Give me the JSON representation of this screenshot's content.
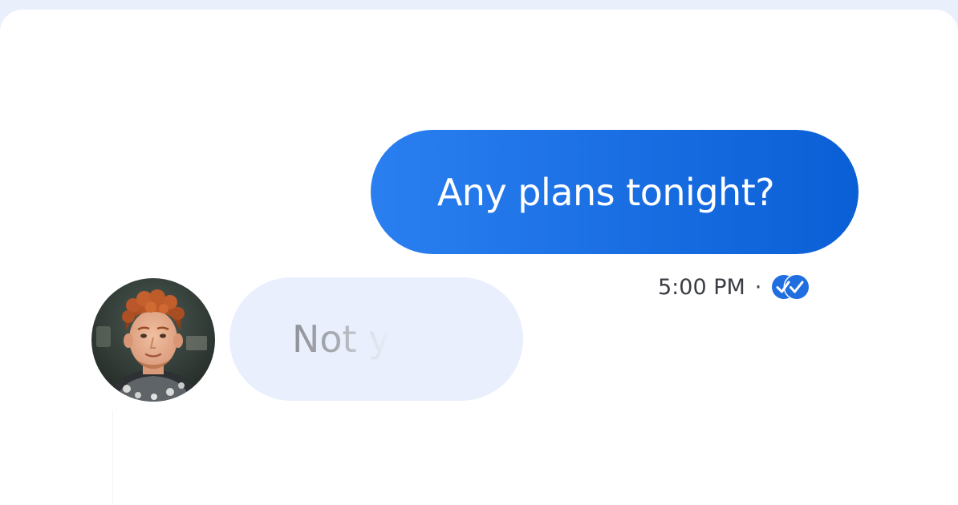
{
  "conversation": {
    "outgoing_message": {
      "text": "Any plans tonight?",
      "time": "5:00 PM",
      "separator": "·",
      "status_icon": "double-check-read-icon"
    },
    "incoming_message": {
      "text": "Not y",
      "sender_avatar": "avatar-photo"
    }
  },
  "colors": {
    "outgoing_bubble_start": "#2a7ff0",
    "outgoing_bubble_end": "#0b5fd6",
    "incoming_bubble": "#e9effc",
    "page_background": "#ffffff",
    "outer_background": "#e9effb",
    "read_receipt": "#1f6fe0"
  }
}
